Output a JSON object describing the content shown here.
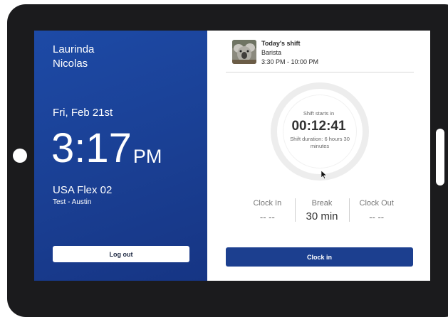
{
  "user": {
    "first_name": "Laurinda",
    "last_name": "Nicolas"
  },
  "clock": {
    "date": "Fri, Feb 21st",
    "time": "3:17",
    "ampm": "PM"
  },
  "location": {
    "name": "USA Flex 02",
    "sub": "Test - Austin"
  },
  "left_actions": {
    "logout_label": "Log out"
  },
  "shift": {
    "title": "Today's shift",
    "role": "Barista",
    "time_range": "3:30 PM - 10:00 PM",
    "avatar_icon": "koala-photo"
  },
  "timer": {
    "label": "Shift starts in",
    "countdown": "00:12:41",
    "duration_text": "Shift duration: 6 hours 30 minutes"
  },
  "stats": [
    {
      "label": "Clock In",
      "value": "-- --"
    },
    {
      "label": "Break",
      "value": "30 min"
    },
    {
      "label": "Clock Out",
      "value": "-- --"
    }
  ],
  "right_actions": {
    "clockin_label": "Clock in"
  },
  "colors": {
    "panel_blue": "#1d4aa6",
    "button_blue": "#1c3f8f",
    "device_frame": "#1b1b1d"
  }
}
